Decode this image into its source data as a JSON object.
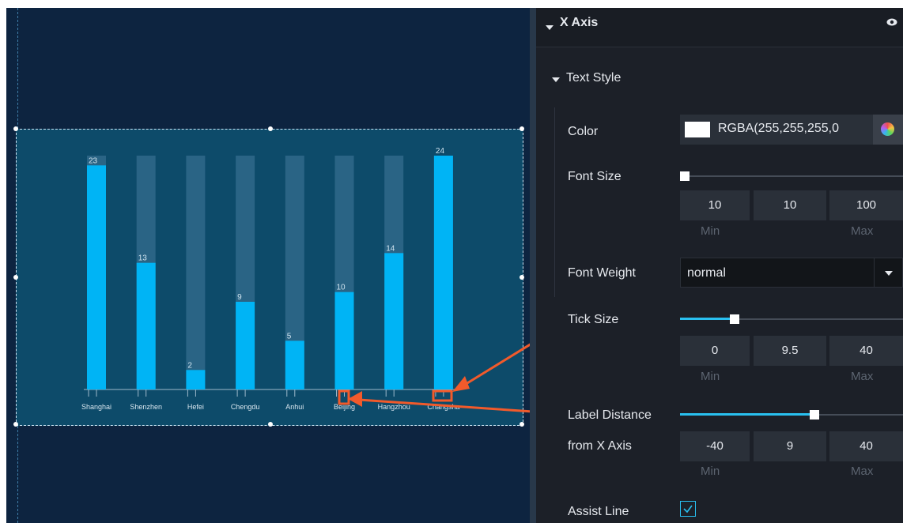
{
  "chart_data": {
    "type": "bar",
    "categories": [
      "Shanghai",
      "Shenzhen",
      "Hefei",
      "Chengdu",
      "Anhui",
      "Beijing",
      "Hangzhou",
      "Changsha"
    ],
    "values": [
      23,
      13,
      2,
      9,
      5,
      10,
      14,
      24
    ],
    "value_labels": [
      "23",
      "13",
      "2",
      "9",
      "5",
      "10",
      "14",
      "24"
    ],
    "ylim": [
      0,
      24
    ],
    "title": "",
    "xlabel": "",
    "ylabel": "",
    "colors": {
      "bar": "#00b4f5",
      "background_bar": "#2a6485",
      "axis": "#9fb9cb",
      "annotation": "#f15a2b"
    }
  },
  "panel": {
    "section_title": "X Axis",
    "eye_icon": "eye-icon",
    "text_style_title": "Text Style",
    "color": {
      "label": "Color",
      "value": "RGBA(255,255,255,0",
      "picker_icon": "color-wheel-icon"
    },
    "font_size": {
      "label": "Font Size",
      "current": "10",
      "min": "10",
      "max": "100",
      "min_label": "Min",
      "max_label": "Max",
      "level": 0.0
    },
    "font_weight": {
      "label": "Font Weight",
      "value": "normal"
    },
    "tick_size": {
      "label": "Tick Size",
      "current": "0",
      "value": "9.5",
      "max": "40",
      "min_label": "Min",
      "max_label": "Max",
      "level": 0.2375
    },
    "label_distance": {
      "label_line1": "Label Distance",
      "label_line2": "from X Axis",
      "min": "-40",
      "value": "9",
      "max": "40",
      "min_label": "Min",
      "max_label": "Max",
      "level": 0.6125
    },
    "assist_line": {
      "label": "Assist Line",
      "checked": true
    }
  }
}
